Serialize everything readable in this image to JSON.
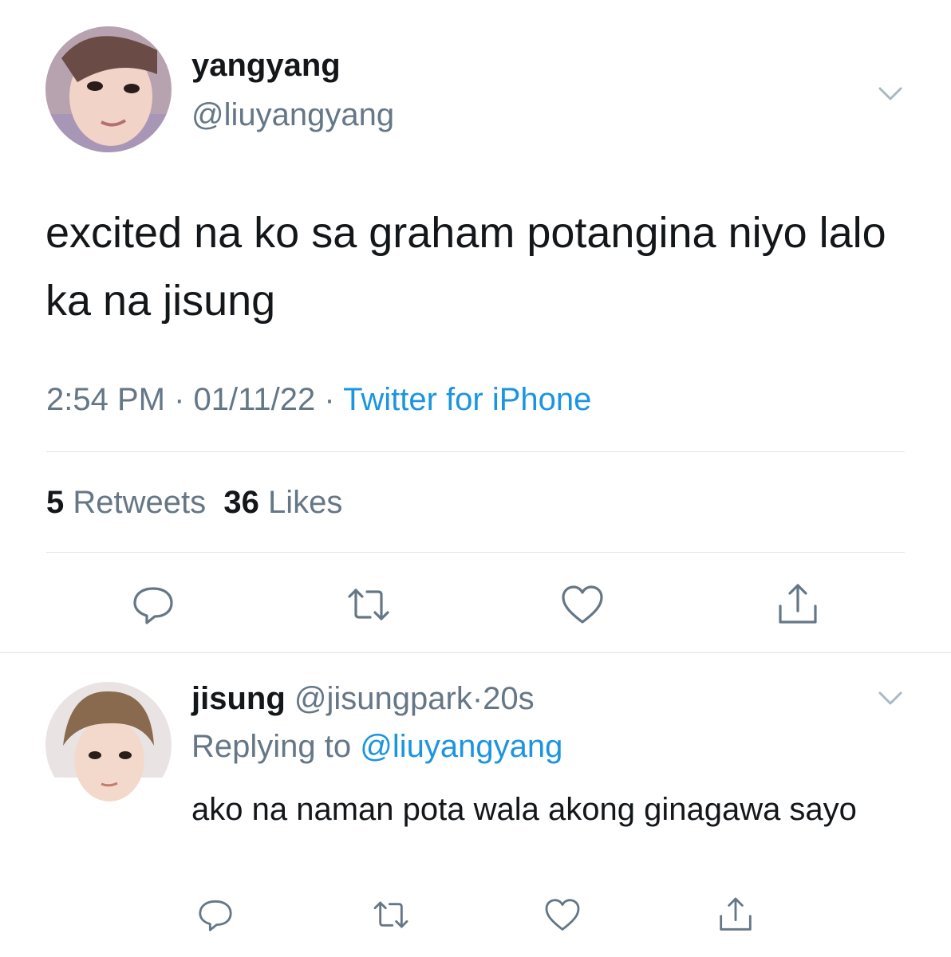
{
  "main_tweet": {
    "display_name": "yangyang",
    "handle": "@liuyangyang",
    "text": "excited na ko sa graham potangina niyo lalo ka na jisung",
    "time": "2:54 PM",
    "sep1": "·",
    "date": "01/11/22",
    "sep2": "·",
    "source": "Twitter for iPhone",
    "retweets_count": "5",
    "retweets_label": "Retweets",
    "likes_count": "36",
    "likes_label": "Likes",
    "actions": [
      "reply-icon",
      "retweet-icon",
      "like-icon",
      "share-icon"
    ]
  },
  "reply_tweet": {
    "display_name": "jisung",
    "handle": "@jisungpark",
    "sep": "·",
    "age": "20s",
    "replying_label": "Replying to",
    "replying_handle": "@liuyangyang",
    "text": "ako na naman pota wala akong ginagawa sayo",
    "actions": [
      "reply-icon",
      "retweet-icon",
      "like-icon",
      "share-icon"
    ]
  },
  "colors": {
    "text": "#14171a",
    "secondary": "#657786",
    "link": "#1b95e0",
    "divider": "#dfe3e6"
  }
}
